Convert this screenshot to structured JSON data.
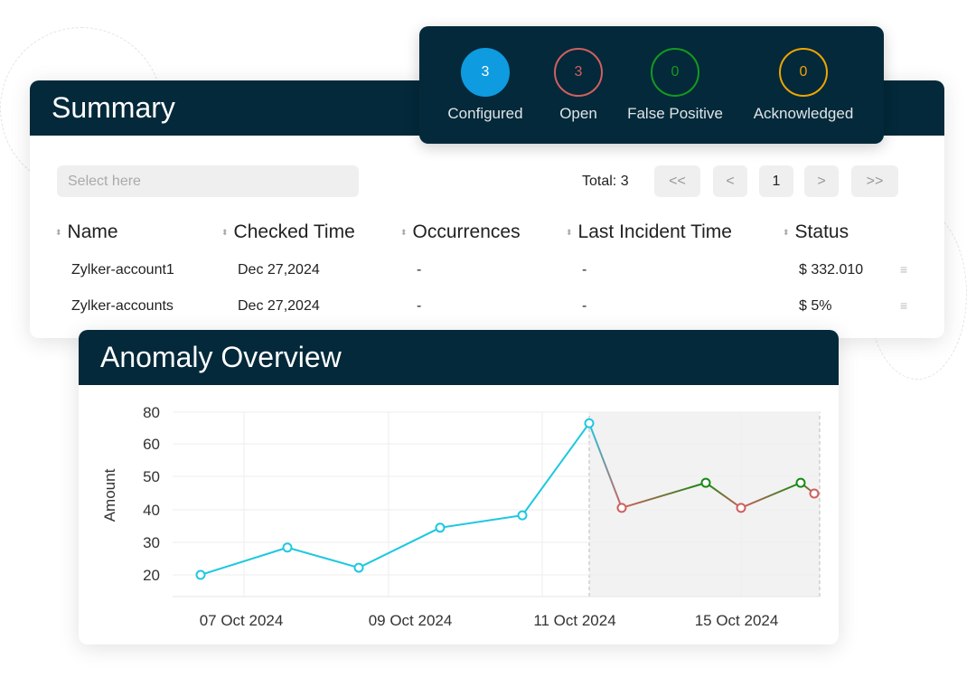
{
  "pills": [
    {
      "count": "3",
      "label": "Configured",
      "color": "#0e9be0",
      "filled": true
    },
    {
      "count": "3",
      "label": "Open",
      "color": "#d0605e",
      "filled": false
    },
    {
      "count": "0",
      "label": "False Positive",
      "color": "#149a1f",
      "filled": false
    },
    {
      "count": "0",
      "label": "Acknowledged",
      "color": "#f0a500",
      "filled": false
    }
  ],
  "summary": {
    "title": "Summary",
    "select_placeholder": "Select here",
    "total": "Total: 3",
    "pager": {
      "first": "<<",
      "prev": "<",
      "page": "1",
      "next": ">",
      "last": ">>"
    },
    "columns": [
      "Name",
      "Checked Time",
      "Occurrences",
      "Last Incident Time",
      "Status"
    ],
    "rows": [
      [
        "Zylker-account1",
        "Dec 27,2024",
        "-",
        "-",
        "$ 332.010"
      ],
      [
        "Zylker-accounts",
        "Dec 27,2024",
        "-",
        "-",
        "$ 5%"
      ]
    ],
    "row_menu_icon": "hamburger-icon"
  },
  "anomaly": {
    "title": "Anomaly Overview"
  },
  "chart_data": {
    "type": "line",
    "ylabel": "Amount",
    "yticks": [
      "80",
      "60",
      "50",
      "40",
      "30",
      "20"
    ],
    "xticks": [
      "07 Oct 2024",
      "09 Oct 2024",
      "11 Oct 2024",
      "15 Oct 2024"
    ],
    "grid": true,
    "values": [
      20,
      28.4,
      22.2,
      34.5,
      38.3,
      66.6,
      40.6,
      48.3,
      40.6,
      48.3,
      45
    ],
    "point_status": [
      "normal",
      "normal",
      "normal",
      "normal",
      "normal",
      "normal",
      "open",
      "false-positive",
      "open",
      "false-positive",
      "open"
    ],
    "colors": {
      "normal": "#1ec8e0",
      "open": "#d0605e",
      "false-positive": "#138a13"
    }
  }
}
